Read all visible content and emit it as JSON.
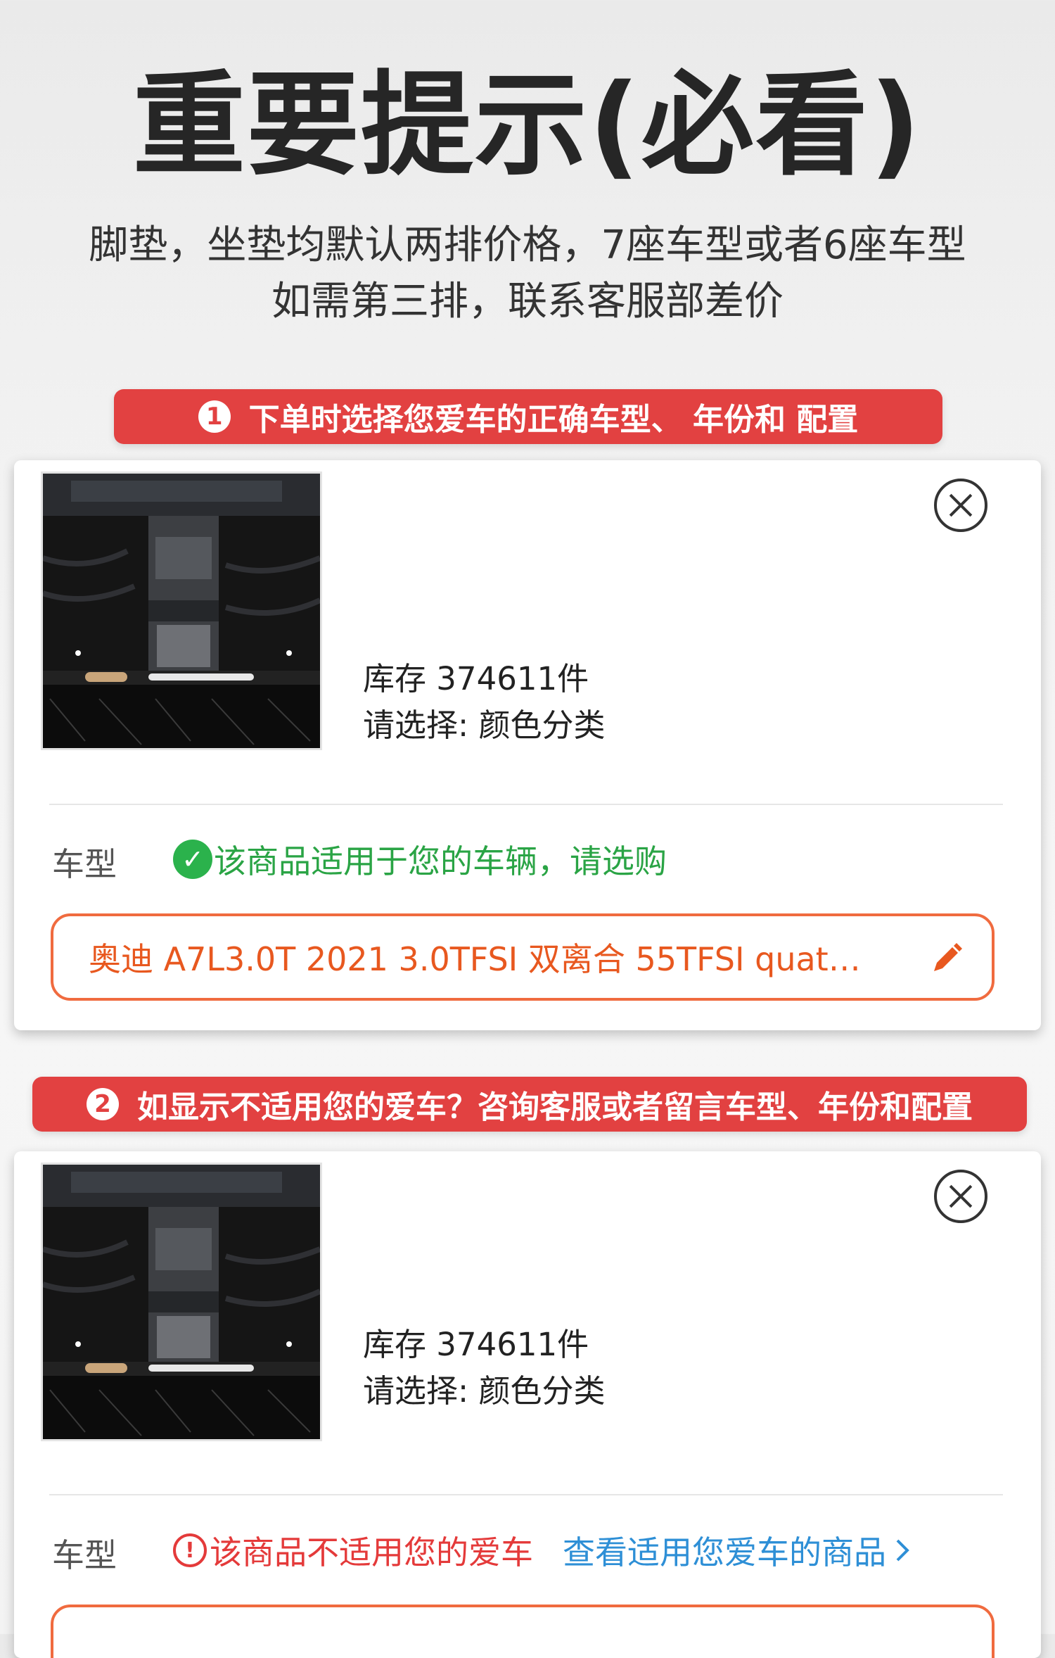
{
  "header": {
    "title": "重要提示(必看)",
    "line1": "脚垫，坐垫均默认两排价格，7座车型或者6座车型",
    "line2": "如需第三排，联系客服部差价"
  },
  "step1": {
    "num": "1",
    "text": "下单时选择您爱车的正确车型、 年份和 配置"
  },
  "step2": {
    "num": "2",
    "text": "如显示不适用您的爱车？咨询客服或者留言车型、年份和配置"
  },
  "colors": {
    "banner": "#e24141",
    "ok": "#2bb24c",
    "warn": "#e43a3a",
    "accent": "#f06b3f",
    "link": "#2e8fd6"
  },
  "card1": {
    "stock": "库存 374611件",
    "select": "请选择: 颜色分类",
    "car_label": "车型",
    "status": "该商品适用于您的车辆，请选购",
    "model": "奥迪 A7L3.0T 2021 3.0TFSI 双离合 55TFSI quat…",
    "icons": [
      "close-icon",
      "check-circle-icon",
      "pencil-icon"
    ]
  },
  "card2": {
    "stock": "库存 374611件",
    "select": "请选择: 颜色分类",
    "car_label": "车型",
    "status": "该商品不适用您的爱车",
    "link": "查看适用您爱车的商品",
    "icons": [
      "close-icon",
      "alert-circle-icon",
      "chevron-right-icon"
    ]
  }
}
